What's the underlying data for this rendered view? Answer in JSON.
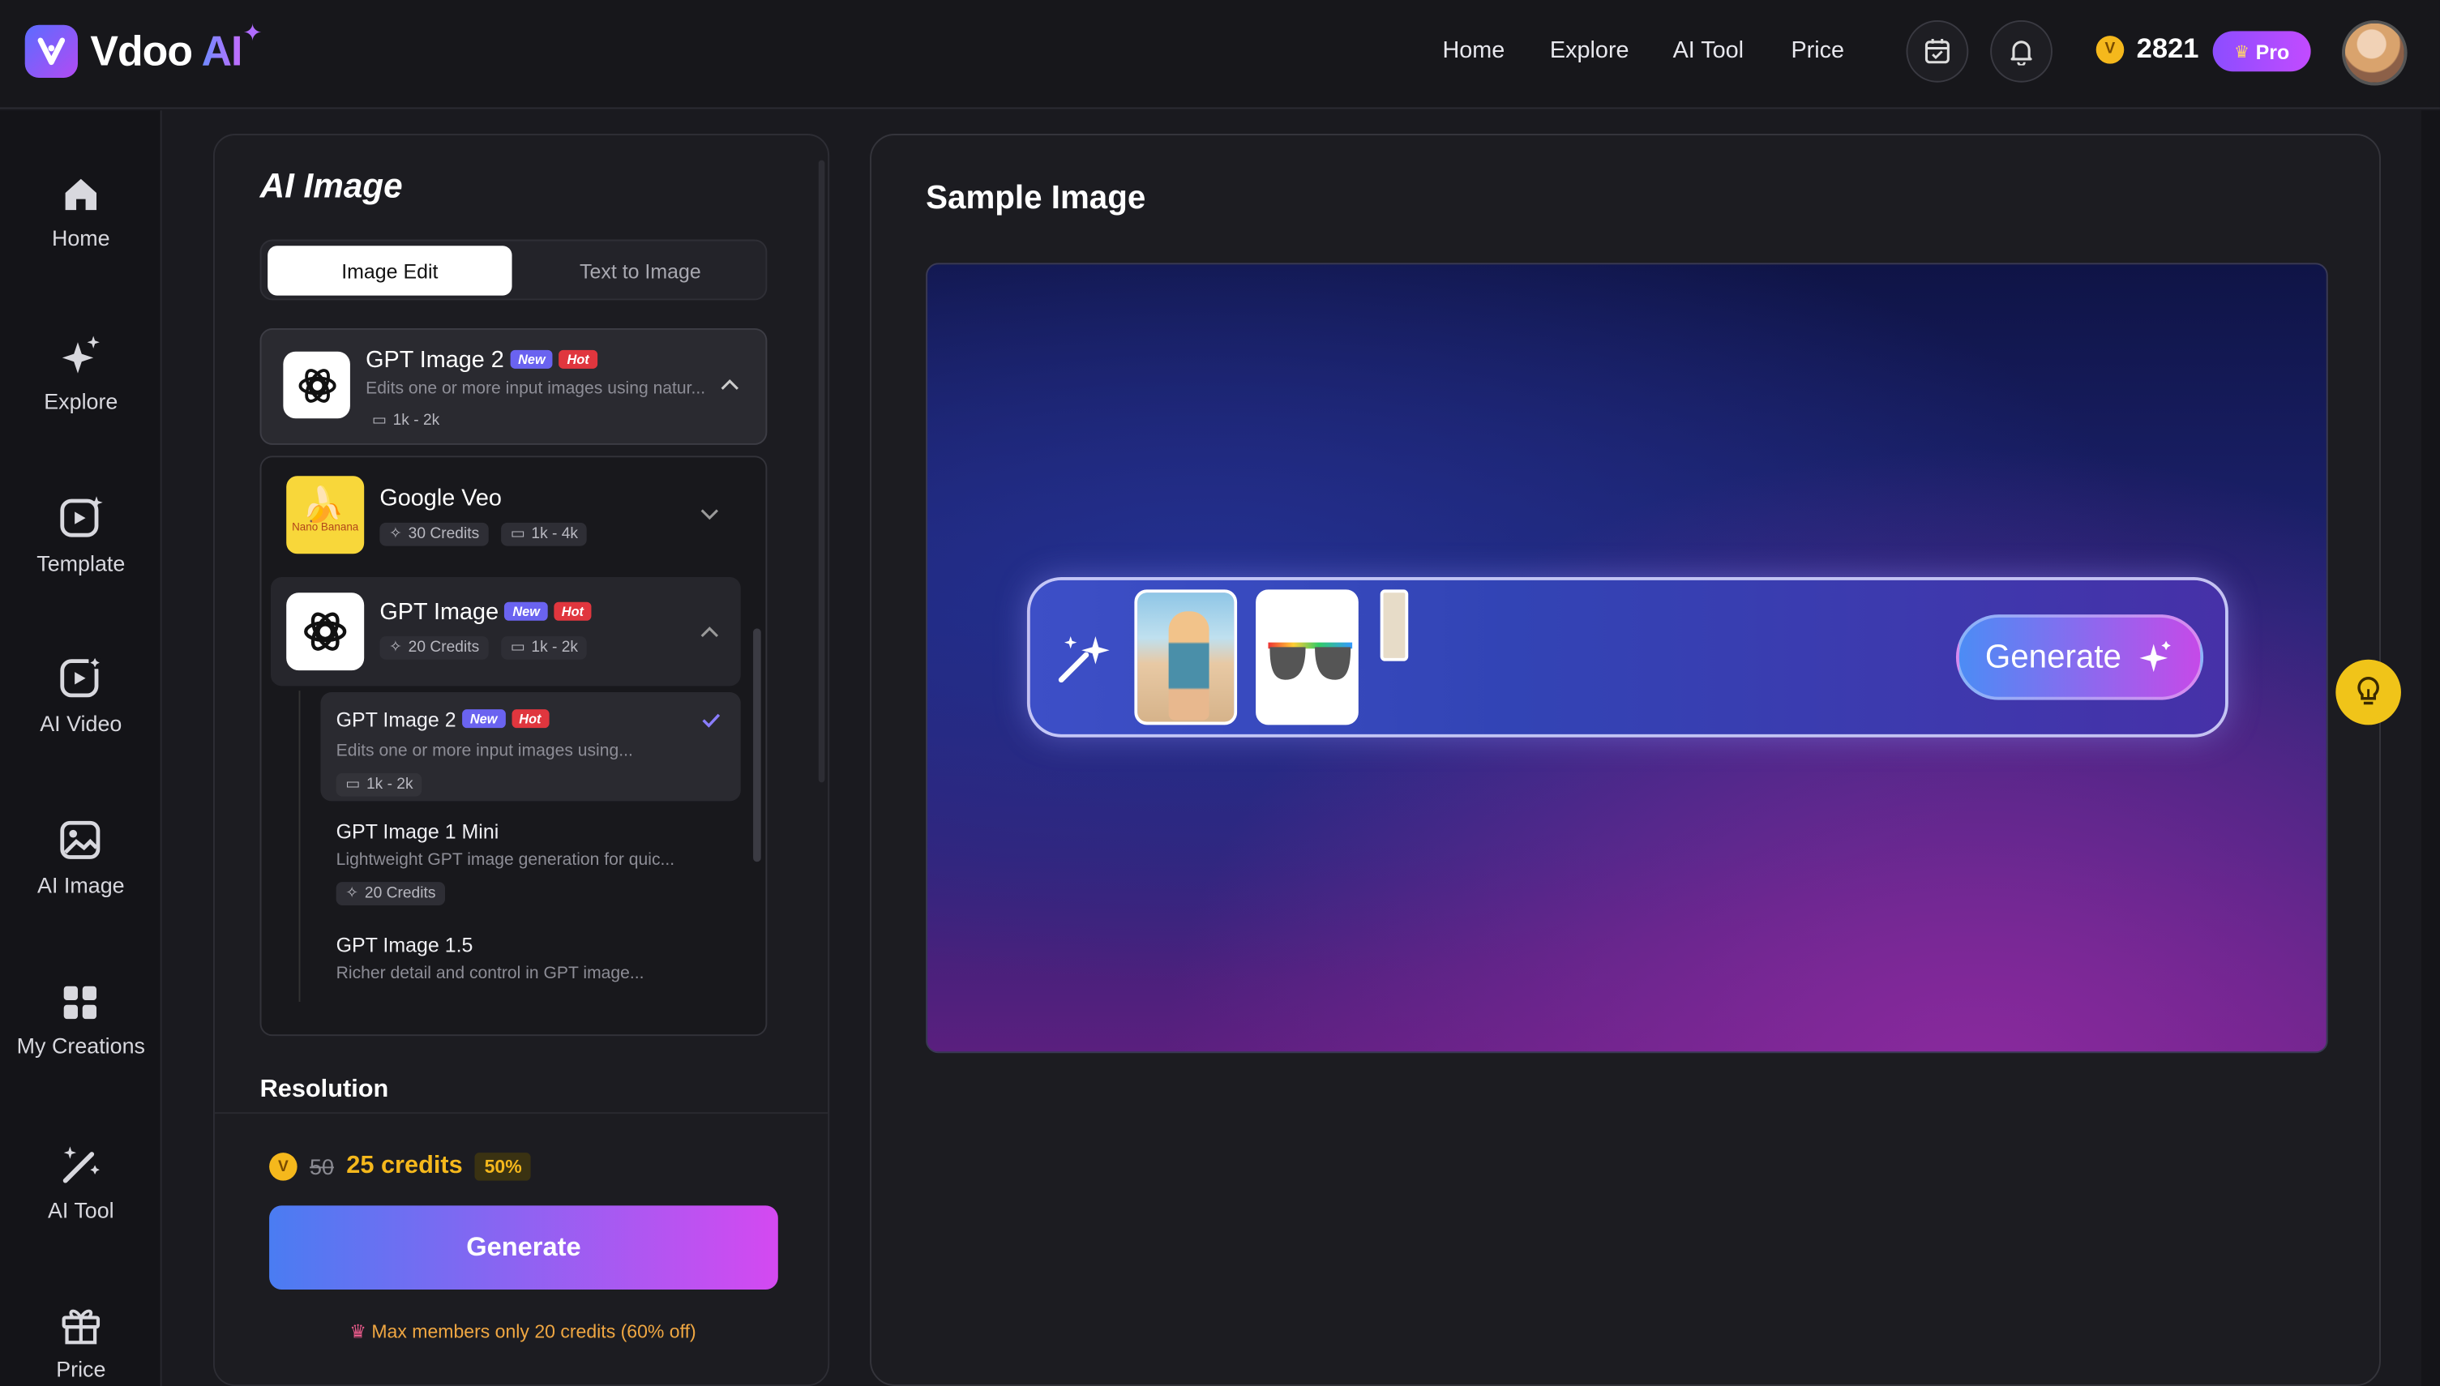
{
  "app": {
    "name": "Vdoo",
    "name_accent": "AI"
  },
  "nav": {
    "links": [
      "Home",
      "Explore",
      "AI Tool",
      "Price"
    ]
  },
  "header": {
    "credits": "2821",
    "pro_label": "Pro"
  },
  "sidebar": {
    "items": [
      {
        "label": "Home",
        "icon": "home-icon"
      },
      {
        "label": "Explore",
        "icon": "sparkle-icon"
      },
      {
        "label": "Template",
        "icon": "template-icon"
      },
      {
        "label": "AI Video",
        "icon": "ai-video-icon"
      },
      {
        "label": "AI Image",
        "icon": "ai-image-icon"
      },
      {
        "label": "My Creations",
        "icon": "grid-icon"
      },
      {
        "label": "AI Tool",
        "icon": "magic-wand-icon"
      },
      {
        "label": "Price",
        "icon": "gift-icon"
      }
    ]
  },
  "panel": {
    "title": "AI Image",
    "tabs": [
      "Image Edit",
      "Text to Image"
    ],
    "active_tab": "Image Edit",
    "selected": {
      "name": "GPT Image 2",
      "badges": [
        "New",
        "Hot"
      ],
      "desc": "Edits one or more input images using natur...",
      "res": "1k - 2k"
    },
    "models": [
      {
        "name": "Google Veo",
        "icon_text": "Nano Banana",
        "credits": "30 Credits",
        "res": "1k - 4k"
      },
      {
        "name": "GPT Image",
        "badges": [
          "New",
          "Hot"
        ],
        "credits": "20 Credits",
        "res": "1k - 2k"
      }
    ],
    "sub_models": [
      {
        "name": "GPT Image 2",
        "badges": [
          "New",
          "Hot"
        ],
        "desc": "Edits one or more input images using...",
        "res": "1k - 2k",
        "selected": true
      },
      {
        "name": "GPT Image 1 Mini",
        "desc": "Lightweight GPT image generation for quic...",
        "credits": "20 Credits"
      },
      {
        "name": "GPT Image 1.5",
        "desc": "Richer detail and control in GPT image..."
      }
    ],
    "resolution_label": "Resolution",
    "price": {
      "old": "50",
      "new": "25 credits",
      "discount": "50%"
    },
    "generate_label": "Generate",
    "member_note": "Max members only 20 credits (60% off)"
  },
  "sample": {
    "title": "Sample Image",
    "generate_label": "Generate"
  },
  "colors": {
    "accent_gradient_start": "#4a7cf2",
    "accent_gradient_end": "#d449f1",
    "coin": "#f5b81c",
    "new_badge": "#6a63f0",
    "hot_badge": "#e0363e"
  }
}
